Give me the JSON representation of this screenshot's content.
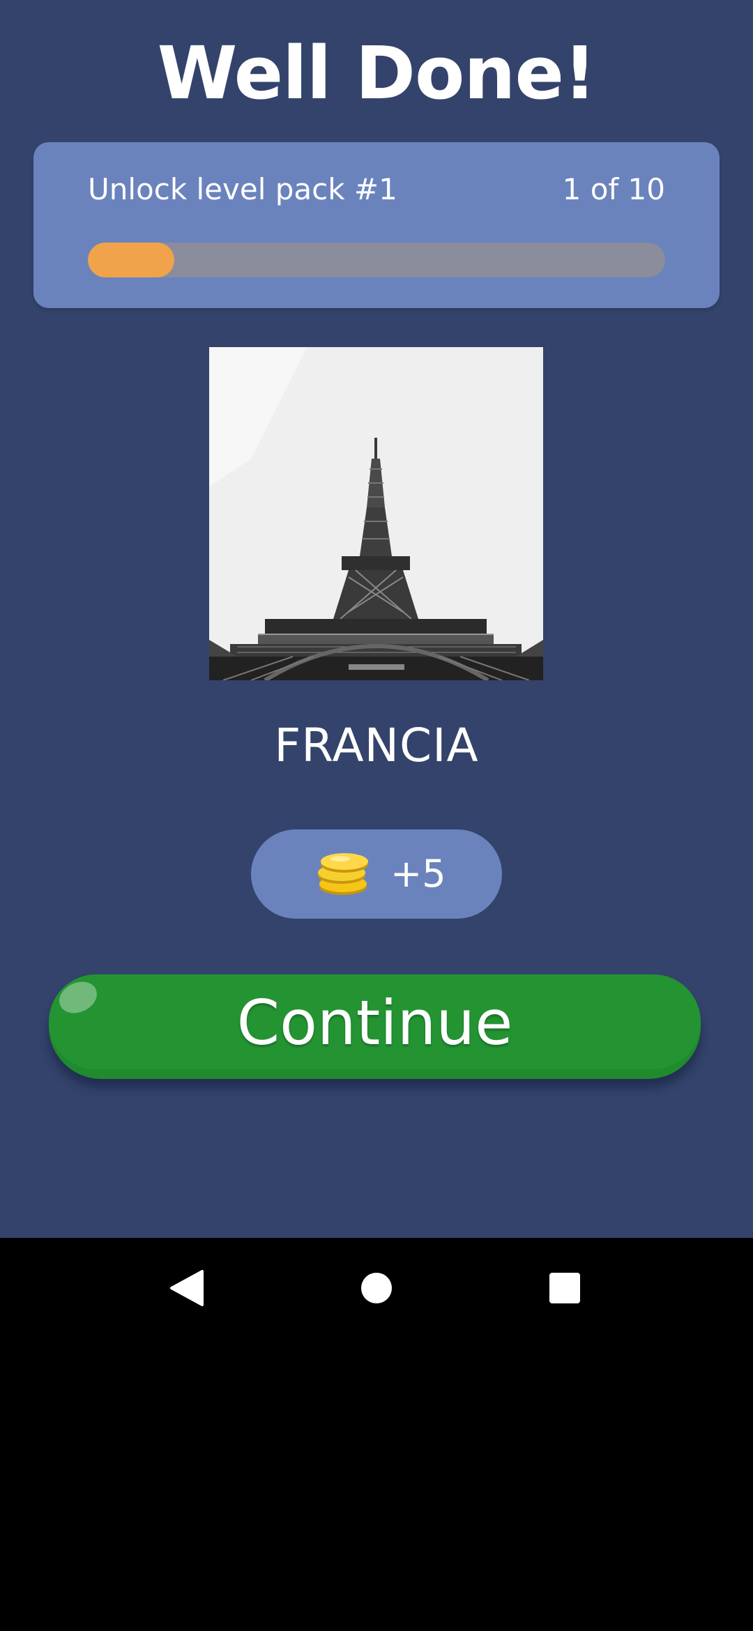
{
  "header": {
    "title": "Well Done!"
  },
  "progress": {
    "label": "Unlock level pack #1",
    "count_text": "1 of 10",
    "fraction": 0.1,
    "track_color": "#8b8c9c",
    "fill_color": "#f0a34a"
  },
  "photo": {
    "icon": "eiffel-tower-photo"
  },
  "answer": {
    "text": "FRANCIA"
  },
  "reward": {
    "icon": "coin-stack-icon",
    "text": "+5"
  },
  "continue_button": {
    "label": "Continue",
    "color": "#249433"
  },
  "system_nav": {
    "back_icon": "back-triangle-icon",
    "home_icon": "home-circle-icon",
    "recents_icon": "recents-square-icon"
  },
  "colors": {
    "background": "#33436b",
    "card": "#6b83bd",
    "text": "#ffffff"
  }
}
